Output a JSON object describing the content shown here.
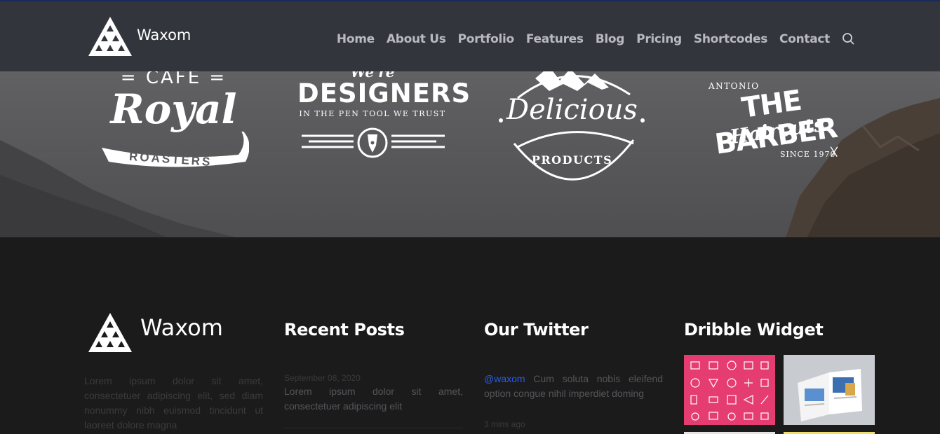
{
  "header": {
    "brand": "Waxom",
    "nav": [
      "Home",
      "About Us",
      "Portfolio",
      "Features",
      "Blog",
      "Pricing",
      "Shortcodes",
      "Contact"
    ],
    "search_icon": "search-icon"
  },
  "clients": {
    "cafe": {
      "top": "= CAFE =",
      "main": "Royal",
      "ribbon": "ROASTERS"
    },
    "designers": {
      "top": "We're",
      "main": "DESIGNERS",
      "tagline": "IN THE PEN TOOL WE TRUST"
    },
    "delicious": {
      "main": "Delicious",
      "sub": "PRODUCTS"
    },
    "barber": {
      "top": "ANTONIO",
      "main": "THE BARBER",
      "script": "Haircuts",
      "since": "SINCE 1970"
    }
  },
  "footer": {
    "brand": "Waxom",
    "about": "Lorem ipsum dolor sit amet, consectetuer adipiscing elit, sed diam nonummy nibh euismod tincidunt ut laoreet dolore magna",
    "recent_posts": {
      "title": "Recent Posts",
      "date": "September 08, 2020",
      "text": "Lorem ipsum dolor sit amet, consectetuer adipiscing elit"
    },
    "twitter": {
      "title": "Our Twitter",
      "handle": "@waxom",
      "text": " Cum soluta nobis eleifend option congue nihil imperdiet doming",
      "time": "3 mins ago"
    },
    "dribbble": {
      "title": "Dribble Widget"
    }
  },
  "colors": {
    "header_bg": "#32353c",
    "footer_bg": "#1b1b1c",
    "link": "#2b5ce6",
    "pink_tile": "#e53d71"
  }
}
